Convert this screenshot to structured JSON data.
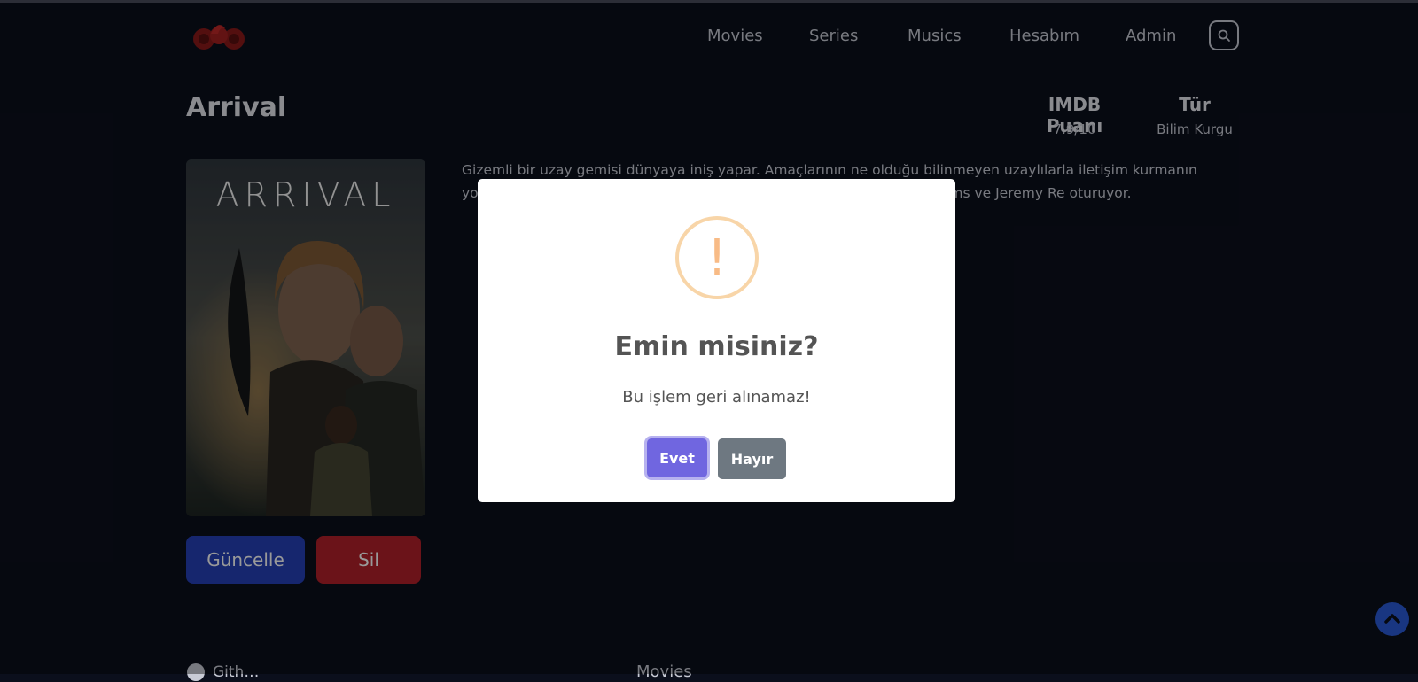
{
  "nav": {
    "items": [
      {
        "label": "Movies"
      },
      {
        "label": "Series"
      },
      {
        "label": "Musics"
      },
      {
        "label": "Hesabım"
      },
      {
        "label": "Admin"
      }
    ],
    "search_icon": "search-icon",
    "logo": "dragon-logo"
  },
  "movie": {
    "title": "Arrival",
    "imdb_label": "IMDB Puanı",
    "imdb_value": "7.9/10",
    "genre_label": "Tür",
    "genre_value": "Bilim Kurgu",
    "poster_text": "ARRIVAL",
    "description": "Gizemli bir uzay gemisi dünyaya iniş yapar. Amaçlarının ne olduğu bilinmeyen uzaylılarla iletişim kurmanın yolları ara                                                                                 e Banks hükümet tarafından göreve ça                                                                                  Başrollerini Amy Adams ve Jeremy Re                                                                                  oturuyor."
  },
  "actions": {
    "update_label": "Güncelle",
    "delete_label": "Sil"
  },
  "footer": {
    "github_label": "Gith…",
    "movies_label": "Movies"
  },
  "modal": {
    "icon": "warning-icon",
    "icon_glyph": "!",
    "title": "Emin misiniz?",
    "text": "Bu işlem geri alınamaz!",
    "confirm_label": "Evet",
    "cancel_label": "Hayır"
  },
  "colors": {
    "background": "#0b0f1c",
    "update_button": "#2540b8",
    "delete_button": "#b3212a",
    "confirm_button": "#7066e0",
    "cancel_button": "#6e7881",
    "warning": "#f8bb86"
  }
}
